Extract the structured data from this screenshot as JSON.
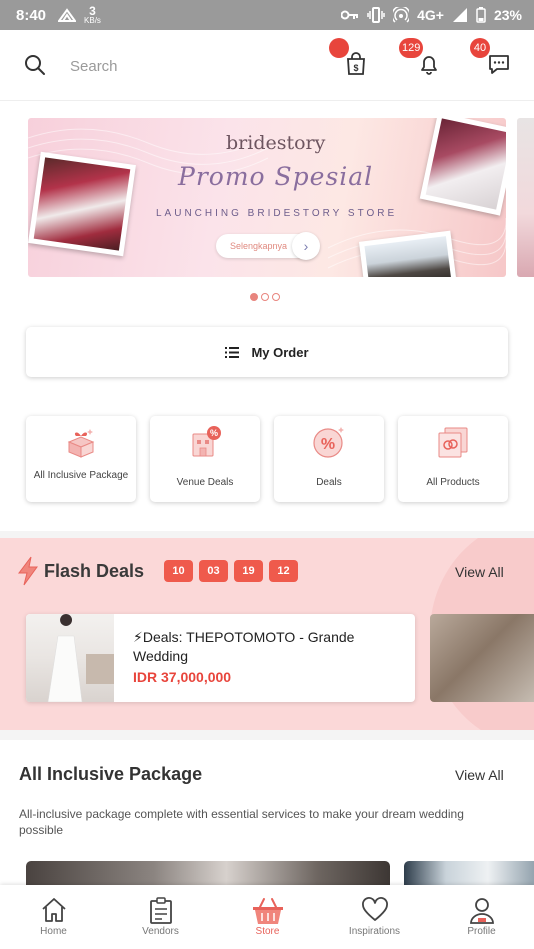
{
  "status_bar": {
    "time": "8:40",
    "net_speed_value": "3",
    "net_speed_unit": "KB/s",
    "network": "4G+",
    "battery": "23%"
  },
  "header": {
    "search_placeholder": "Search",
    "cart_badge": "",
    "notification_badge": "129",
    "message_badge": "40"
  },
  "banner": {
    "brand": "bridestory",
    "headline": "Promo Spesial",
    "tagline": "LAUNCHING BRIDESTORY STORE",
    "cta": "Selengkapnya",
    "dots_count": 3,
    "active_dot": 0
  },
  "my_order": {
    "label": "My Order"
  },
  "categories": [
    {
      "label": "All Inclusive Package",
      "icon": "gift-box-icon"
    },
    {
      "label": "Venue Deals",
      "icon": "venue-discount-icon"
    },
    {
      "label": "Deals",
      "icon": "percent-icon"
    },
    {
      "label": "All Products",
      "icon": "products-icon"
    }
  ],
  "flash_deals": {
    "title": "Flash Deals",
    "timer": [
      "10",
      "03",
      "19",
      "12"
    ],
    "view_all": "View All",
    "deal": {
      "name": "⚡Deals: THEPOTOMOTO - Grande Wedding",
      "price": "IDR 37,000,000"
    }
  },
  "package": {
    "title": "All Inclusive Package",
    "view_all": "View All",
    "description": "All-inclusive package complete with essential services to make your dream wedding possible"
  },
  "bottom_nav": [
    {
      "label": "Home",
      "icon": "home-icon"
    },
    {
      "label": "Vendors",
      "icon": "clipboard-icon"
    },
    {
      "label": "Store",
      "icon": "basket-icon",
      "active": true
    },
    {
      "label": "Inspirations",
      "icon": "heart-icon"
    },
    {
      "label": "Profile",
      "icon": "profile-icon"
    }
  ],
  "colors": {
    "accent": "#e8453c",
    "flash_bg": "#fbd8d8",
    "active_nav": "#e8625a"
  }
}
